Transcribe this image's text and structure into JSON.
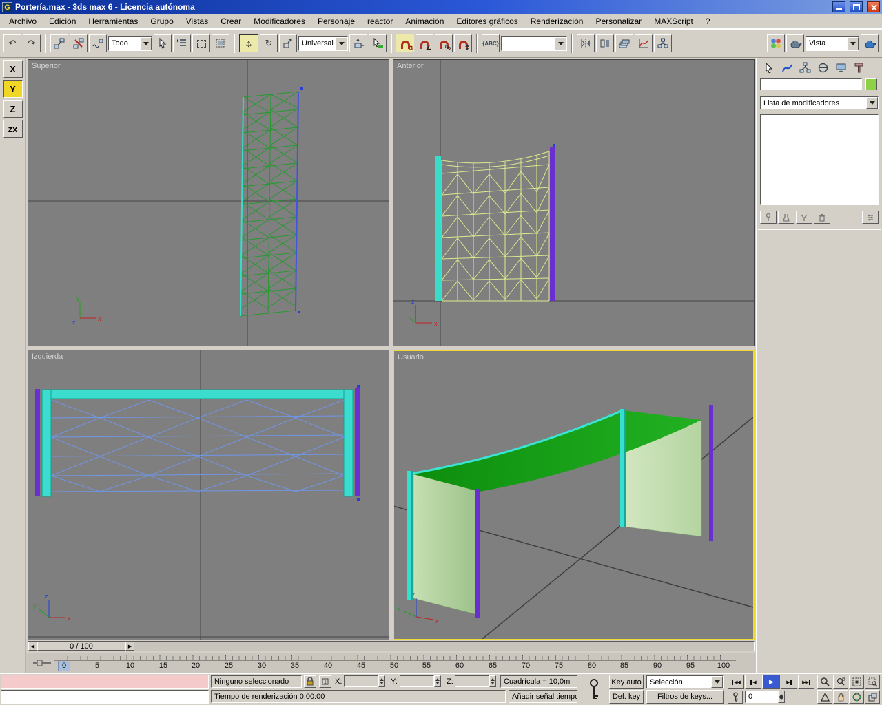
{
  "window": {
    "icon_letter": "G",
    "title": "Portería.max - 3ds max 6 - Licencia autónoma"
  },
  "menu": {
    "items": [
      "Archivo",
      "Edición",
      "Herramientas",
      "Grupo",
      "Vistas",
      "Crear",
      "Modificadores",
      "Personaje",
      "reactor",
      "Animación",
      "Editores gráficos",
      "Renderización",
      "Personalizar",
      "MAXScript",
      "?"
    ]
  },
  "toolbar": {
    "selection_filter": "Todo",
    "coord_system": "Universal",
    "named_selection": "",
    "render_type": "Vista",
    "snap_count": "3"
  },
  "axis_constraints": {
    "x": "X",
    "y": "Y",
    "z": "Z",
    "plane": "zx"
  },
  "viewports": {
    "superior": "Superior",
    "anterior": "Anterior",
    "izquierda": "Izquierda",
    "usuario": "Usuario"
  },
  "command_panel": {
    "object_name": "",
    "modifier_list": "Lista de modificadores"
  },
  "time_slider": {
    "label": "0 / 100"
  },
  "track_bar": {
    "ticks": [
      "0",
      "5",
      "10",
      "15",
      "20",
      "25",
      "30",
      "35",
      "40",
      "45",
      "50",
      "55",
      "60",
      "65",
      "70",
      "75",
      "80",
      "85",
      "90",
      "95",
      "100"
    ]
  },
  "status_bar": {
    "listener_input": "",
    "listener_output": "",
    "selection_status": "Ninguno seleccionado",
    "x_label": "X:",
    "y_label": "Y:",
    "z_label": "Z:",
    "x_value": "",
    "y_value": "",
    "z_value": "",
    "grid": "Cuadrícula = 10,0m",
    "prompt": "Tiempo de renderización  0:00:00",
    "add_time_tag": "Añadir señal tiempo",
    "key_auto": "Key auto",
    "def_key": "Def. key",
    "selection_set": "Selección",
    "key_filters": "Filtros de keys...",
    "frame": "0"
  },
  "icons": {
    "undo": "↶",
    "redo": "↷",
    "rotate": "↻",
    "move_h": "↔",
    "move_v": "↕",
    "angle": "∠",
    "percent": "%",
    "named_sets_label": "{ABC}",
    "start": "◀◀",
    "prev": "◀",
    "play": "▶",
    "next": "▶",
    "end": "▶▶",
    "slider_left": "◀",
    "slider_right": "▶"
  },
  "colors": {
    "titlebar_blue": "#2b58d8",
    "active_viewport_border": "#eed832",
    "object_color_swatch": "#8ed046",
    "post_cyan": "#35e0d0",
    "post_purple": "#6a30cf",
    "roof_green": "#159b15",
    "net_panel_green": "#b5d6a0",
    "wire_green": "#259a2e",
    "wire_yellow_green": "#dce98e",
    "wire_blue": "#7096e8",
    "viewport_bg": "#7f7f7f"
  }
}
